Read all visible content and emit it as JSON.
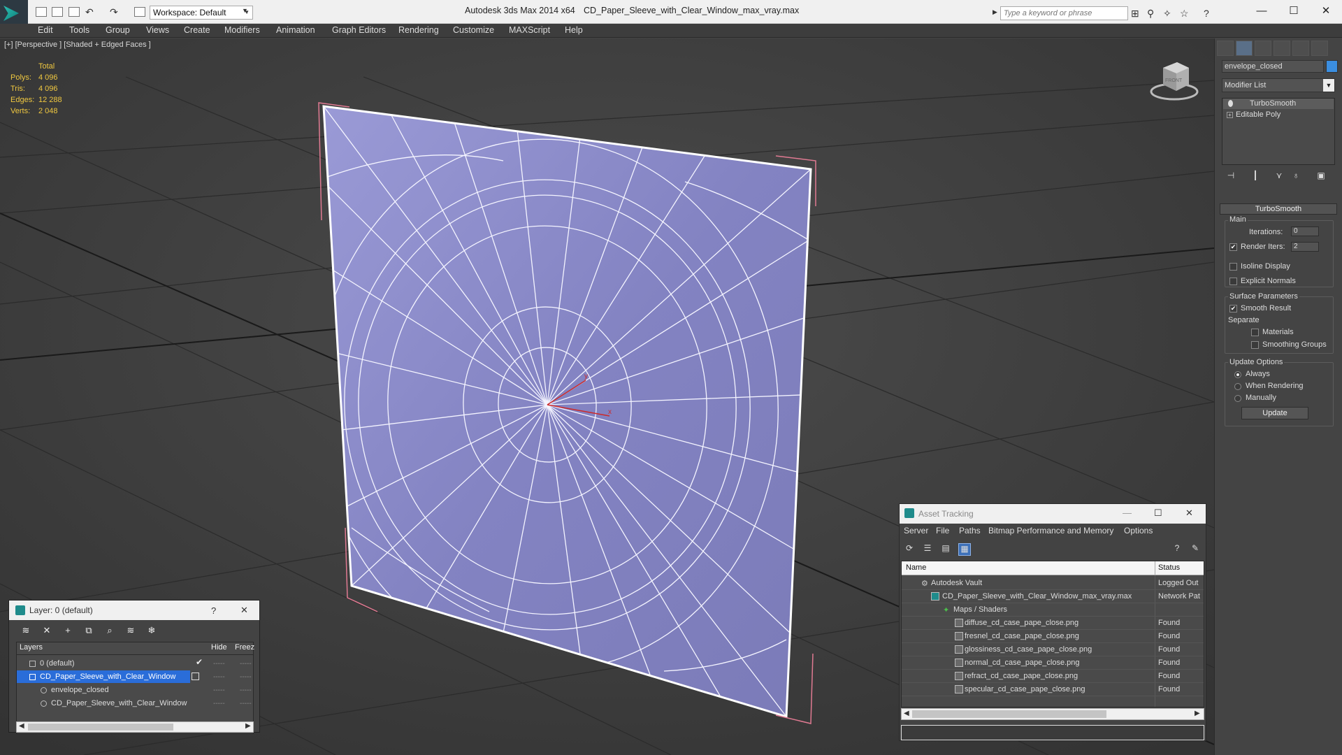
{
  "titlebar": {
    "workspace": "Workspace: Default",
    "app_title": "Autodesk 3ds Max  2014 x64",
    "file_title": "CD_Paper_Sleeve_with_Clear_Window_max_vray.max",
    "search_placeholder": "Type a keyword or phrase"
  },
  "menu": [
    "Edit",
    "Tools",
    "Group",
    "Views",
    "Create",
    "Modifiers",
    "Animation",
    "Graph Editors",
    "Rendering",
    "Customize",
    "MAXScript",
    "Help"
  ],
  "viewport": {
    "label": "[+] [Perspective ] [Shaded + Edged Faces ]",
    "stats_header": "Total",
    "stats": [
      {
        "label": "Polys:",
        "value": "4 096"
      },
      {
        "label": "Tris:",
        "value": "4 096"
      },
      {
        "label": "Edges:",
        "value": "12 288"
      },
      {
        "label": "Verts:",
        "value": "2 048"
      }
    ],
    "axis_x": "x",
    "axis_y": "y",
    "viewcube_face": "FRONT"
  },
  "command_panel": {
    "object_name": "envelope_closed",
    "object_color": "#3b8ee0",
    "modifier_list": "Modifier List",
    "stack": [
      "TurboSmooth",
      "Editable Poly"
    ],
    "rollout_title": "TurboSmooth",
    "main_label": "Main",
    "iterations_label": "Iterations:",
    "iterations_value": "0",
    "render_iters_label": "Render Iters:",
    "render_iters_value": "2",
    "render_iters_checked": true,
    "isoline_label": "Isoline Display",
    "explicit_label": "Explicit Normals",
    "surface_label": "Surface Parameters",
    "smooth_result_label": "Smooth Result",
    "separate_label": "Separate",
    "materials_label": "Materials",
    "smoothing_groups_label": "Smoothing Groups",
    "update_options_label": "Update Options",
    "always_label": "Always",
    "when_rendering_label": "When Rendering",
    "manually_label": "Manually",
    "update_button": "Update"
  },
  "layer_dialog": {
    "title": "Layer: 0 (default)",
    "help": "?",
    "col_layers": "Layers",
    "col_hide": "Hide",
    "col_freeze": "Freez",
    "rows": [
      {
        "name": "0 (default)"
      },
      {
        "name": "CD_Paper_Sleeve_with_Clear_Window"
      },
      {
        "name": "envelope_closed"
      },
      {
        "name": "CD_Paper_Sleeve_with_Clear_Window"
      }
    ],
    "dash": "-----"
  },
  "asset_tracking": {
    "title": "Asset Tracking",
    "menu": [
      "Server",
      "File",
      "Paths",
      "Bitmap Performance and Memory",
      "Options"
    ],
    "col_name": "Name",
    "col_status": "Status",
    "rows": [
      {
        "name": "Autodesk Vault",
        "status": "Logged Out"
      },
      {
        "name": "CD_Paper_Sleeve_with_Clear_Window_max_vray.max",
        "status": "Network Pat"
      },
      {
        "name": "Maps / Shaders",
        "status": ""
      },
      {
        "name": "diffuse_cd_case_pape_close.png",
        "status": "Found"
      },
      {
        "name": "fresnel_cd_case_pape_close.png",
        "status": "Found"
      },
      {
        "name": "glossiness_cd_case_pape_close.png",
        "status": "Found"
      },
      {
        "name": "normal_cd_case_pape_close.png",
        "status": "Found"
      },
      {
        "name": "refract_cd_case_pape_close.png",
        "status": "Found"
      },
      {
        "name": "specular_cd_case_pape_close.png",
        "status": "Found"
      }
    ]
  }
}
